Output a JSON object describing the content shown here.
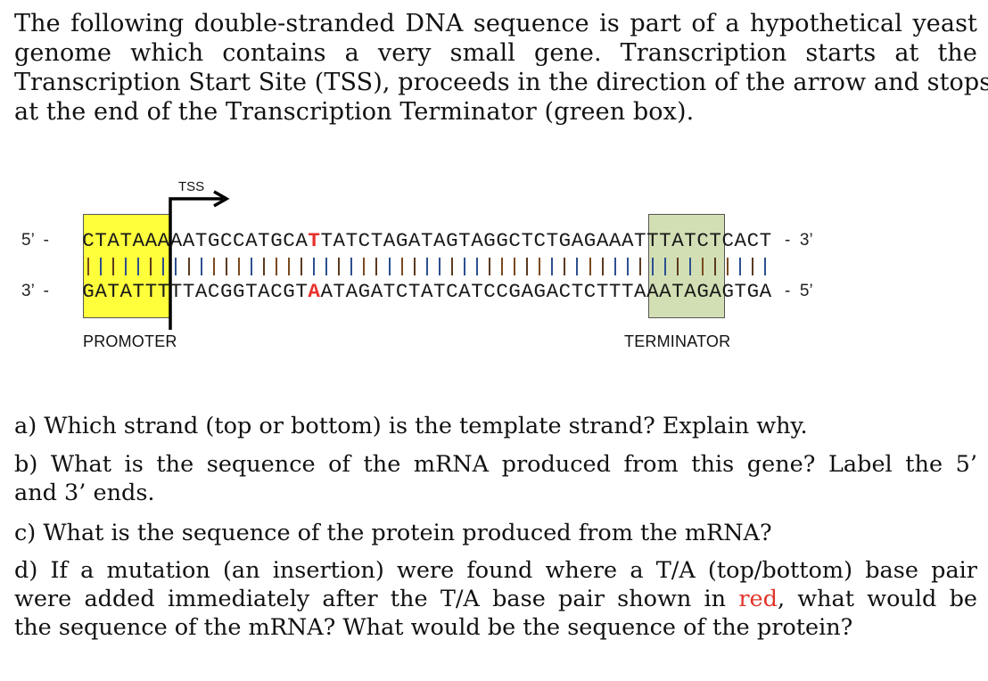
{
  "intro": {
    "lines": [
      "The following double-stranded DNA sequence is part of a hypothetical yeast",
      "genome which contains a very small gene. Transcription starts at the",
      "Transcription Start Site (TSS), proceeds in the direction of the arrow and stops",
      "at the end of the Transcription Terminator (green box)."
    ]
  },
  "diagram": {
    "tss_label": "TSS",
    "top_strand": {
      "left_label": "5’  -",
      "right_label": "-  3’",
      "sequence": "CTATAAAAATGCCATGCATTATCTAGATAGTAGGCTCTGAGAAATTTATCTCACT",
      "highlight_index": 18,
      "highlight_color": "#e8302a"
    },
    "bottom_strand": {
      "left_label": "3’  -",
      "right_label": "-  5’",
      "sequence": "GATATTTTTACGGTACGTAATAGATCTATCATCCGAGACTCTTTAAATAGAGTGA",
      "highlight_index": 18,
      "highlight_color": "#e8302a"
    },
    "promoter": {
      "label": "PROMOTER",
      "start": 0,
      "end": 6,
      "color": "#ffff3c"
    },
    "terminator": {
      "label": "TERMINATOR",
      "start": 45,
      "end": 50,
      "color": "#d2dfb4"
    }
  },
  "questions": {
    "a": {
      "lines": [
        "a) Which strand (top or bottom) is the template strand? Explain why."
      ]
    },
    "b": {
      "lines": [
        "b) What is the sequence of the mRNA produced from this gene? Label the 5’",
        "and 3’ ends."
      ]
    },
    "c": {
      "lines": [
        "c) What is the sequence of the protein produced from the mRNA?"
      ]
    },
    "d": {
      "line1": "d) If a mutation (an insertion) were found where a T/A (top/bottom) base pair",
      "line2_before": "were added immediately after the T/A base pair shown in ",
      "line2_red": "red",
      "line2_after": ", what would be",
      "line3": "the sequence of the mRNA? What would be the sequence of the protein?"
    }
  }
}
